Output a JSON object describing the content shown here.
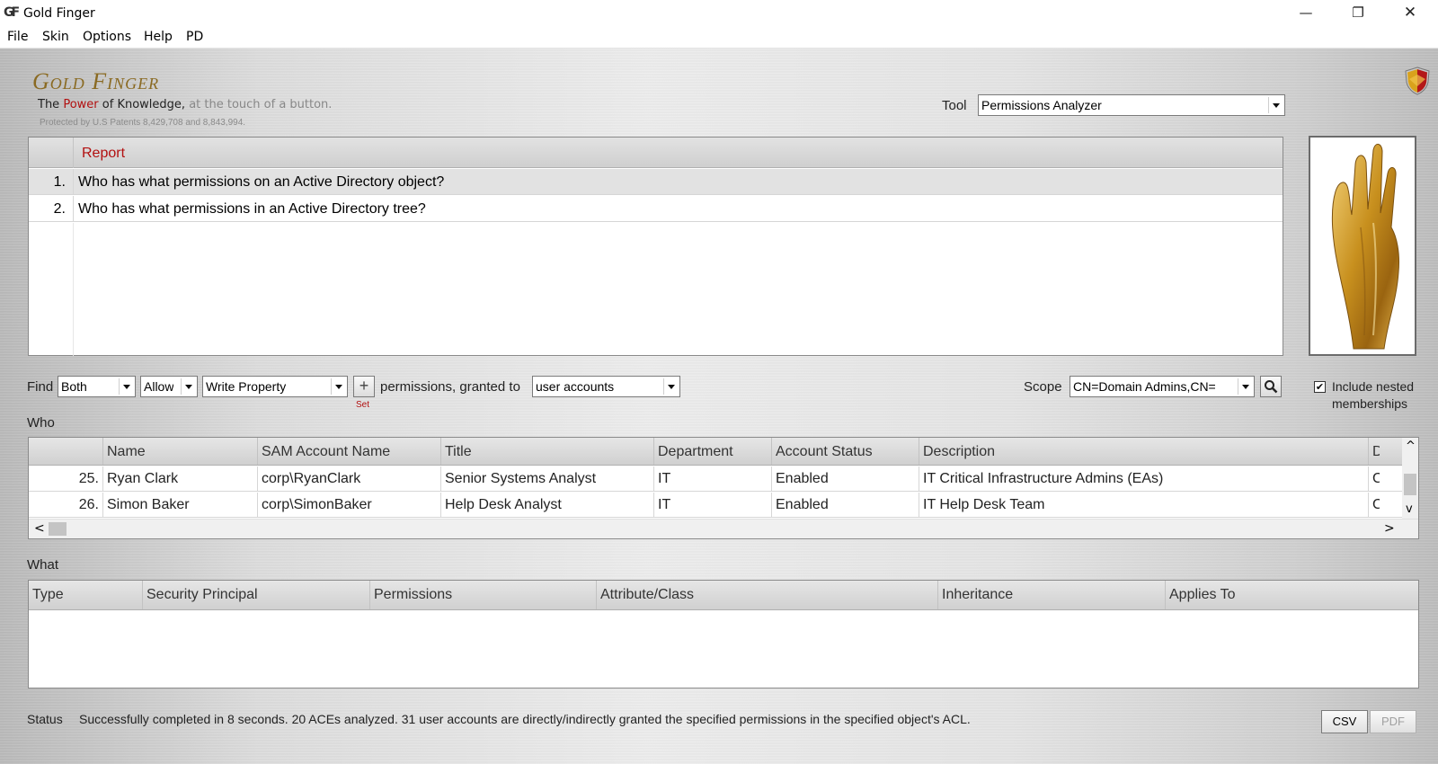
{
  "window": {
    "icon_text": "GF",
    "title": "Gold Finger",
    "minimize": "—",
    "maximize": "❐",
    "close": "✕"
  },
  "menu": [
    "File",
    "Skin",
    "Options",
    "Help",
    "PD"
  ],
  "brand": {
    "title": "Gold Finger",
    "tagline_the": "The",
    "tagline_power": "Power",
    "tagline_of": "of Knowledge,",
    "tagline_touch": "at the touch of a button.",
    "patent": "Protected by U.S Patents 8,429,708 and 8,843,994."
  },
  "tool": {
    "label": "Tool",
    "value": "Permissions Analyzer"
  },
  "report": {
    "header": "Report",
    "rows": [
      {
        "num": "1.",
        "text": "Who has what permissions on an Active Directory object?"
      },
      {
        "num": "2.",
        "text": "Who has what permissions in an Active Directory tree?"
      }
    ]
  },
  "find": {
    "label": "Find",
    "scope_type": "Both",
    "allow": "Allow",
    "permission": "Write Property",
    "add_icon": "+",
    "set_label": "Set",
    "granted_label": "permissions, granted to",
    "granted_to": "user accounts",
    "scope_label": "Scope",
    "scope_value": "CN=Domain Admins,CN=",
    "search_icon": "search-icon",
    "nested_checked": "✔",
    "nested_label_1": "Include nested",
    "nested_label_2": "memberships"
  },
  "who": {
    "label": "Who",
    "columns": [
      "Name",
      "SAM Account Name",
      "Title",
      "Department",
      "Account Status",
      "Description",
      "D"
    ],
    "rows": [
      {
        "num": "25.",
        "name": "Ryan Clark",
        "sam": "corp\\RyanClark",
        "title": "Senior Systems Analyst",
        "dept": "IT",
        "status": "Enabled",
        "desc": "IT Critical Infrastructure Admins (EAs)",
        "extra": "C"
      },
      {
        "num": "26.",
        "name": "Simon Baker",
        "sam": "corp\\SimonBaker",
        "title": "Help Desk Analyst",
        "dept": "IT",
        "status": "Enabled",
        "desc": "IT Help Desk Team",
        "extra": "C"
      }
    ],
    "scroll_left": "<",
    "scroll_right": ">",
    "scroll_up": "^",
    "scroll_down": "v"
  },
  "what": {
    "label": "What",
    "columns": [
      "Type",
      "Security Principal",
      "Permissions",
      "Attribute/Class",
      "Inheritance",
      "Applies To"
    ]
  },
  "status": {
    "label": "Status",
    "text": "Successfully completed in 8 seconds.  20 ACEs analyzed. 31 user accounts are directly/indirectly granted the specified permissions in the specified object's ACL.",
    "csv": "CSV",
    "pdf": "PDF"
  },
  "colors": {
    "accent_red": "#b21010",
    "brand_gold": "#8a6a22"
  }
}
